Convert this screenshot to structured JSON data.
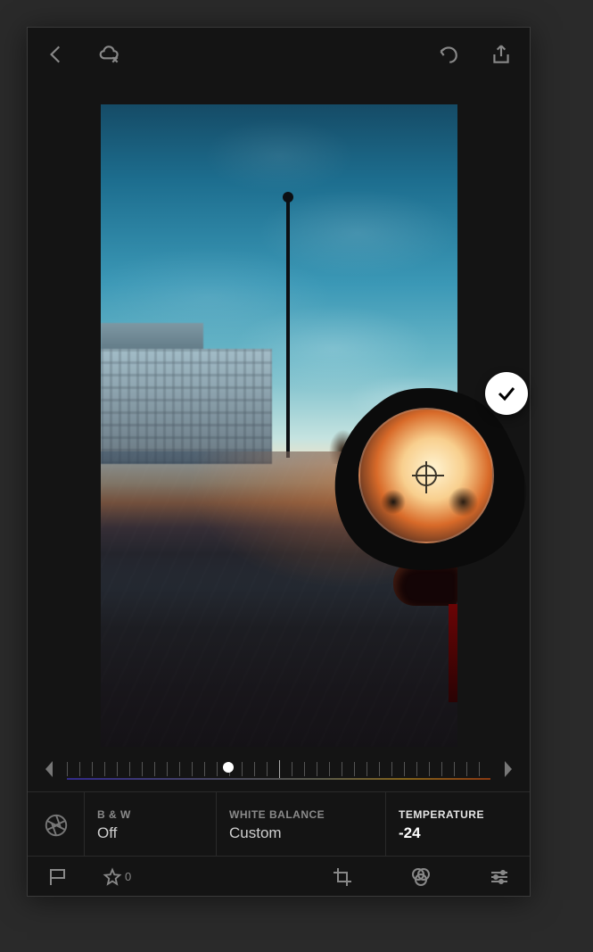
{
  "adjustments": {
    "bw": {
      "label": "B & W",
      "value": "Off"
    },
    "white_balance": {
      "label": "WHITE BALANCE",
      "value": "Custom"
    },
    "temperature": {
      "label": "TEMPERATURE",
      "value": "-24",
      "numeric": -24
    }
  },
  "rating": {
    "count": "0"
  },
  "slider": {
    "handle_percent": 38
  }
}
